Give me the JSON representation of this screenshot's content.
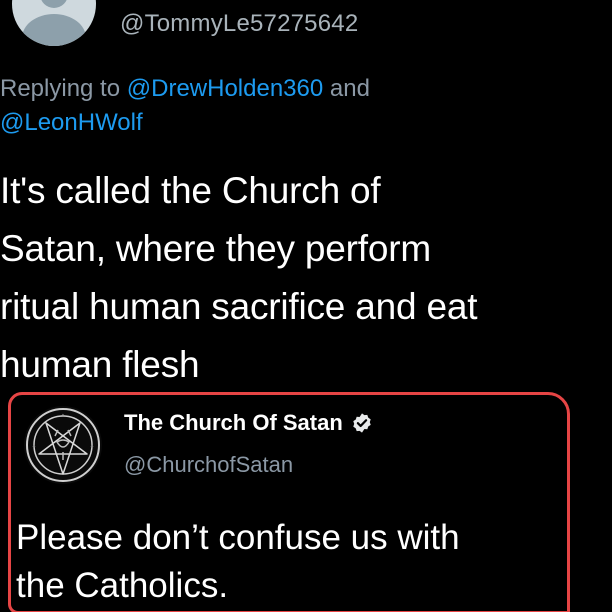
{
  "tweet": {
    "handle": "@TommyLe57275642",
    "replying_prefix": "Replying to ",
    "replying_mention_1": "@DrewHolden360",
    "replying_joiner": " and",
    "replying_mention_2": "@LeonHWolf",
    "text": "It's called the Church of\nSatan, where they perform\nritual human sacrifice and eat\nhuman flesh"
  },
  "quoted": {
    "name": "The Church Of Satan",
    "handle": "@ChurchofSatan",
    "text": "Please don’t confuse us with\nthe Catholics.",
    "icons": [
      "pentagram-logo-icon",
      "verified-badge-icon"
    ]
  },
  "colors": {
    "background": "#000000",
    "mention": "#1d9bf0",
    "highlight_border": "#e64545",
    "secondary_text": "#8b98a5"
  }
}
